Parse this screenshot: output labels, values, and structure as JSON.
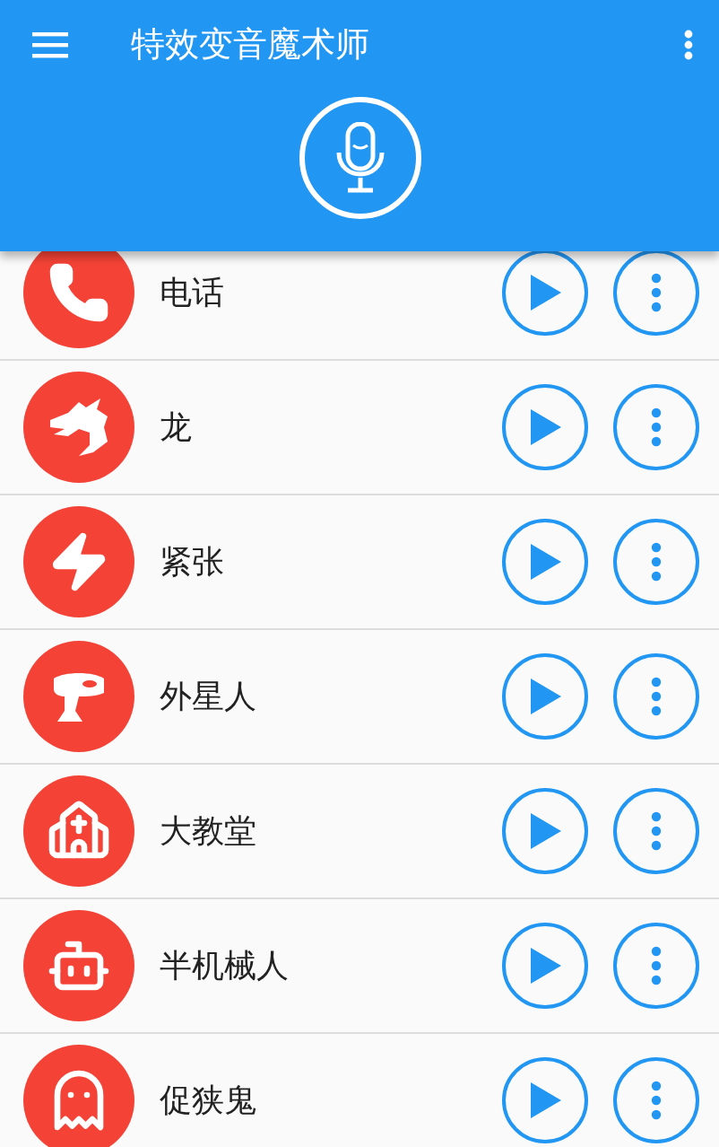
{
  "app_bar": {
    "title": "特效变音魔术师"
  },
  "effects": [
    {
      "name": "电话"
    },
    {
      "name": "龙"
    },
    {
      "name": "紧张"
    },
    {
      "name": "外星人"
    },
    {
      "name": "大教堂"
    },
    {
      "name": "半机械人"
    },
    {
      "name": "促狭鬼"
    }
  ]
}
